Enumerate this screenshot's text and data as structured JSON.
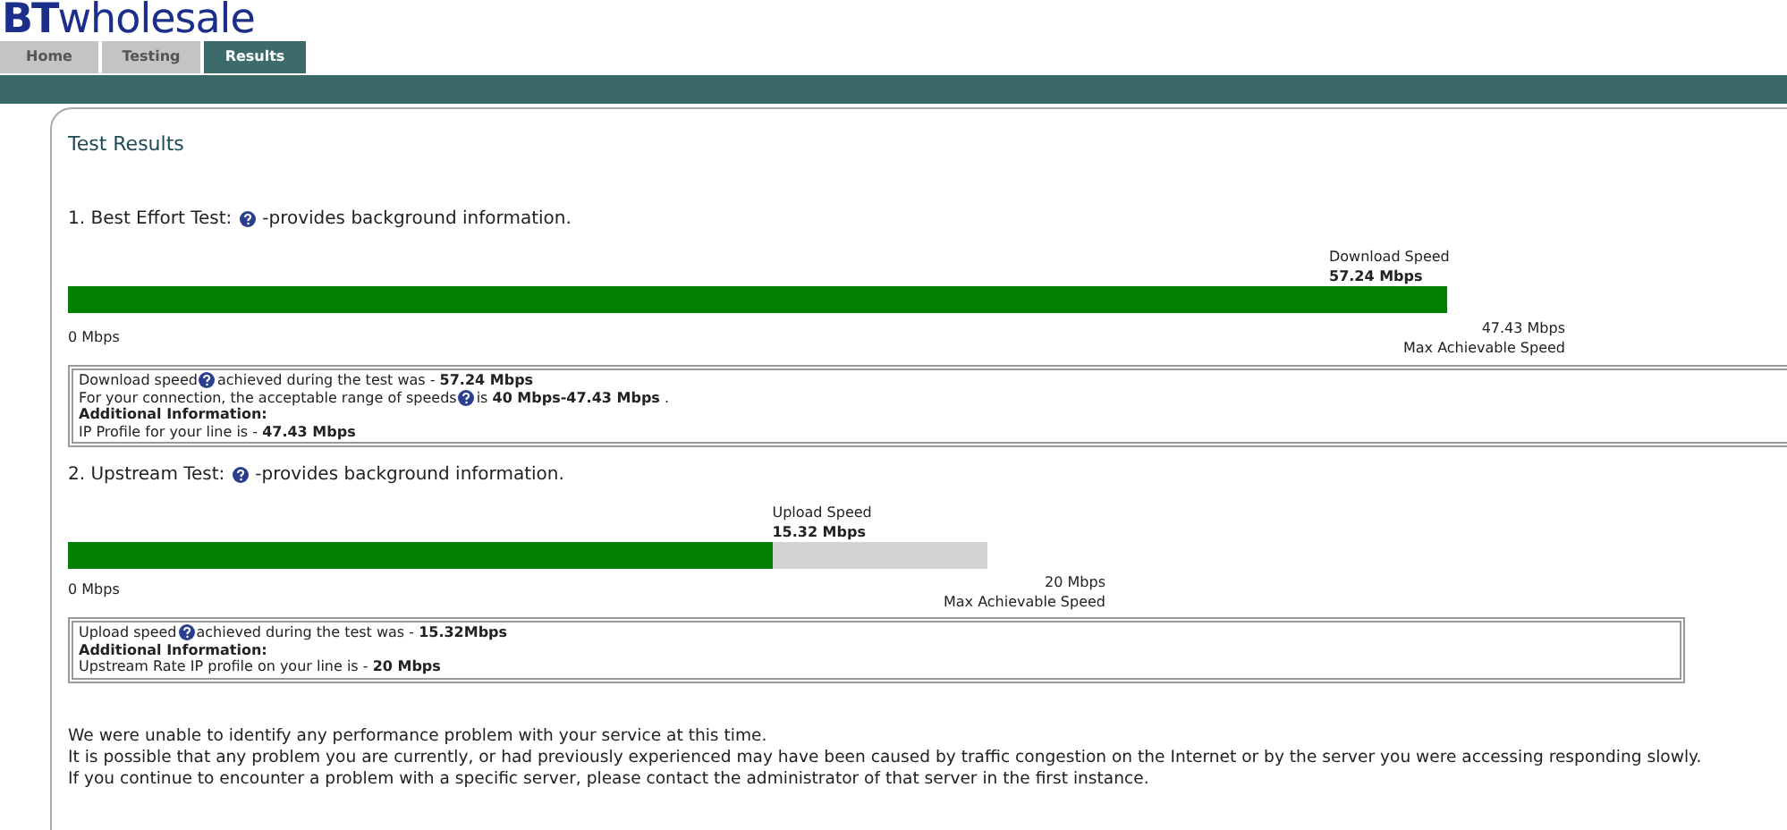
{
  "logo": {
    "bold": "BT",
    "rest": "wholesale"
  },
  "tabs": [
    {
      "label": "Home",
      "selected": false
    },
    {
      "label": "Testing",
      "selected": false
    },
    {
      "label": "Results",
      "selected": true
    }
  ],
  "page_title": "Test Results",
  "tests": [
    {
      "heading": "1. Best Effort Test:",
      "heading_note": "-provides background information.",
      "speed_label": "Download Speed",
      "speed_value": "57.24 Mbps",
      "level": 1,
      "min_label": "0 Mbps",
      "max_value": "47.43 Mbps",
      "max_label": "Max Achievable Speed",
      "info_lines": [
        {
          "kind": "text",
          "before": "Download speed",
          "help": true,
          "after": "achieved during the test was - **57.24 Mbps**"
        },
        {
          "kind": "text",
          "before": "For your connection, the acceptable range of speeds",
          "help": true,
          "after": "is **40 Mbps-47.43 Mbps** ."
        },
        {
          "kind": "heading",
          "before": "Additional Information:",
          "help": false
        },
        {
          "kind": "text",
          "before": "IP Profile for your line is - **47.43 Mbps**",
          "help": false
        }
      ]
    },
    {
      "heading": "2. Upstream Test:",
      "heading_note": "-provides background information.",
      "speed_label": "Upload Speed",
      "speed_value": "15.32 Mbps",
      "level": 0.766,
      "min_label": "0 Mbps",
      "max_value": "20 Mbps",
      "max_label": "Max Achievable Speed",
      "info_lines": [
        {
          "kind": "text",
          "before": "Upload speed",
          "help": true,
          "after": "achieved during the test was - **15.32Mbps**"
        },
        {
          "kind": "heading",
          "before": "Additional Information:",
          "help": false
        },
        {
          "kind": "text",
          "before": "Upstream Rate IP profile on your line is - **20 Mbps**",
          "help": false
        }
      ]
    }
  ],
  "summary": [
    "We were unable to identify any performance problem with your service at this time.",
    "It is possible that any problem you are currently, or had previously experienced may have been caused by traffic congestion on the Internet or by the server you were accessing responding slowly.",
    "If you continue to encounter a problem with a specific server, please contact the administrator of that server in the first instance."
  ]
}
